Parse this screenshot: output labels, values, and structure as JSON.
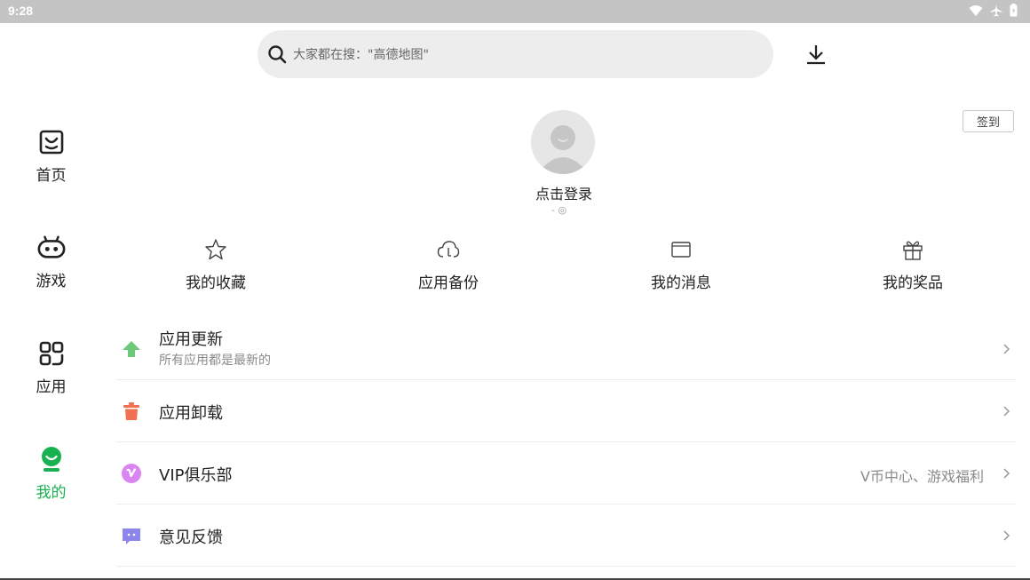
{
  "status_bar": {
    "time": "9:28"
  },
  "search": {
    "placeholder": "大家都在搜：\"高德地图\""
  },
  "nav": {
    "items": [
      {
        "label": "首页",
        "icon": "home-icon"
      },
      {
        "label": "游戏",
        "icon": "gamepad-icon"
      },
      {
        "label": "应用",
        "icon": "apps-icon"
      },
      {
        "label": "我的",
        "icon": "profile-icon",
        "active": true
      }
    ]
  },
  "profile": {
    "login_label": "点击登录",
    "sub_mark": "- ◎",
    "signin_label": "签到"
  },
  "quick_actions": [
    {
      "label": "我的收藏",
      "icon": "star-icon"
    },
    {
      "label": "应用备份",
      "icon": "cloud-backup-icon"
    },
    {
      "label": "我的消息",
      "icon": "message-icon"
    },
    {
      "label": "我的奖品",
      "icon": "gift-icon"
    }
  ],
  "menu": [
    {
      "title": "应用更新",
      "subtitle": "所有应用都是最新的",
      "icon": "update-arrow-icon"
    },
    {
      "title": "应用卸载",
      "icon": "trash-icon"
    },
    {
      "title": "VIP俱乐部",
      "right": "V币中心、游戏福利",
      "icon": "vip-icon"
    },
    {
      "title": "意见反馈",
      "icon": "feedback-icon"
    }
  ],
  "colors": {
    "accent": "#17b14f",
    "update": "#6cc97a",
    "uninstall": "#f0704f",
    "vip": "#d985f2",
    "feedback": "#8d86ea",
    "statusbar": "#c4c4c4",
    "search_bg": "#ededed"
  }
}
